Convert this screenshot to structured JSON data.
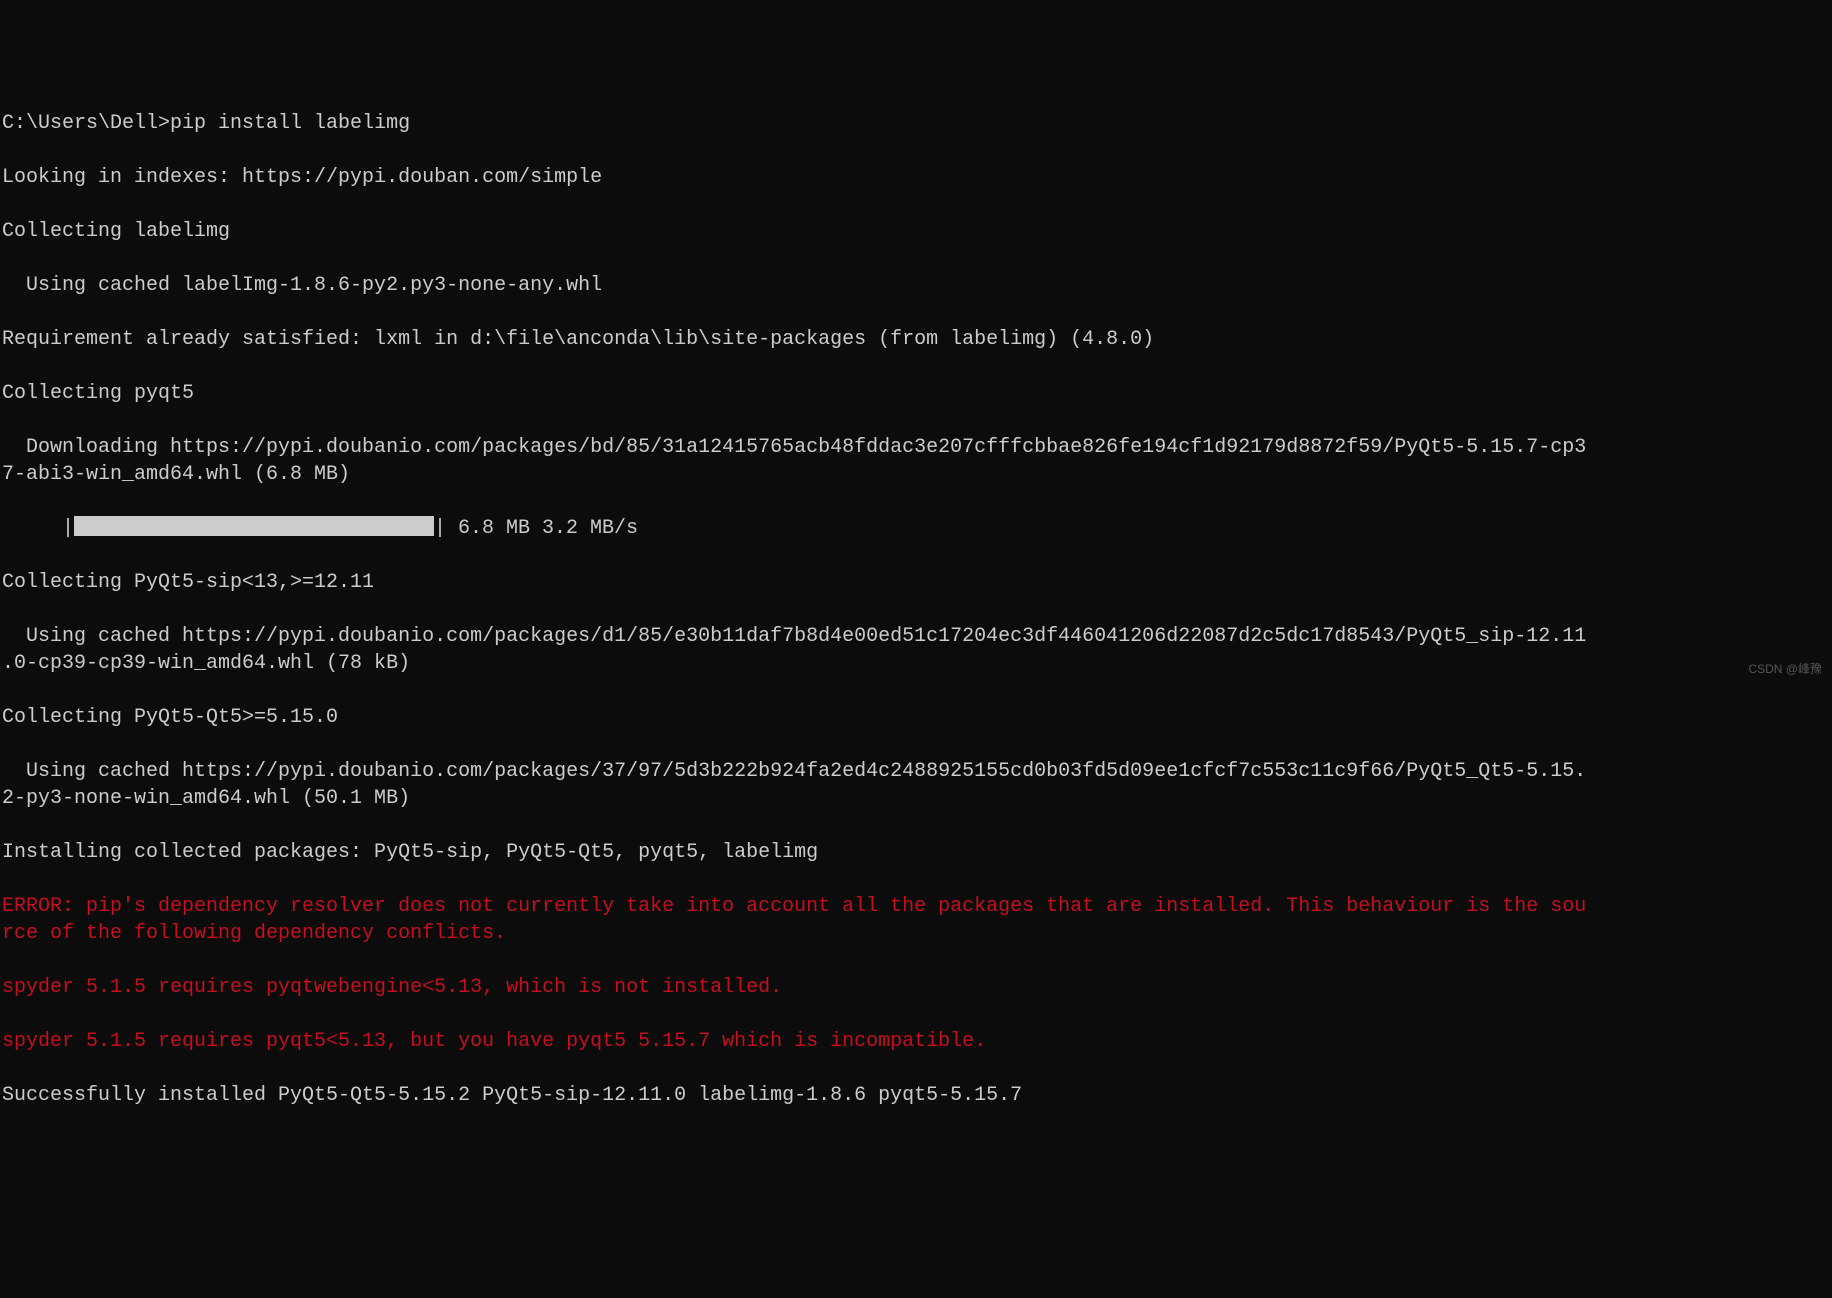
{
  "prompt": "C:\\Users\\Dell>",
  "command": "pip install labelimg",
  "lines": {
    "l1": "Looking in indexes: https://pypi.douban.com/simple",
    "l2": "Collecting labelimg",
    "l3": "  Using cached labelImg-1.8.6-py2.py3-none-any.whl",
    "l4": "Requirement already satisfied: lxml in d:\\file\\anconda\\lib\\site-packages (from labelimg) (4.8.0)",
    "l5": "Collecting pyqt5",
    "l6": "  Downloading https://pypi.doubanio.com/packages/bd/85/31a12415765acb48fddac3e207cfffcbbae826fe194cf1d92179d8872f59/PyQt5-5.15.7-cp37-abi3-win_amd64.whl (6.8 MB)",
    "progress_prefix": "     |",
    "progress_suffix": "| 6.8 MB 3.2 MB/s",
    "l8": "Collecting PyQt5-sip<13,>=12.11",
    "l9": "  Using cached https://pypi.doubanio.com/packages/d1/85/e30b11daf7b8d4e00ed51c17204ec3df446041206d22087d2c5dc17d8543/PyQt5_sip-12.11.0-cp39-cp39-win_amd64.whl (78 kB)",
    "l10": "Collecting PyQt5-Qt5>=5.15.0",
    "l11": "  Using cached https://pypi.doubanio.com/packages/37/97/5d3b222b924fa2ed4c2488925155cd0b03fd5d09ee1cfcf7c553c11c9f66/PyQt5_Qt5-5.15.2-py3-none-win_amd64.whl (50.1 MB)",
    "l12": "Installing collected packages: PyQt5-sip, PyQt5-Qt5, pyqt5, labelimg",
    "err1": "ERROR: pip's dependency resolver does not currently take into account all the packages that are installed. This behaviour is the source of the following dependency conflicts.",
    "err2": "spyder 5.1.5 requires pyqtwebengine<5.13, which is not installed.",
    "err3": "spyder 5.1.5 requires pyqt5<5.13, but you have pyqt5 5.15.7 which is incompatible.",
    "l13": "Successfully installed PyQt5-Qt5-5.15.2 PyQt5-sip-12.11.0 labelimg-1.8.6 pyqt5-5.15.7"
  },
  "watermark": "CSDN @峰豫"
}
